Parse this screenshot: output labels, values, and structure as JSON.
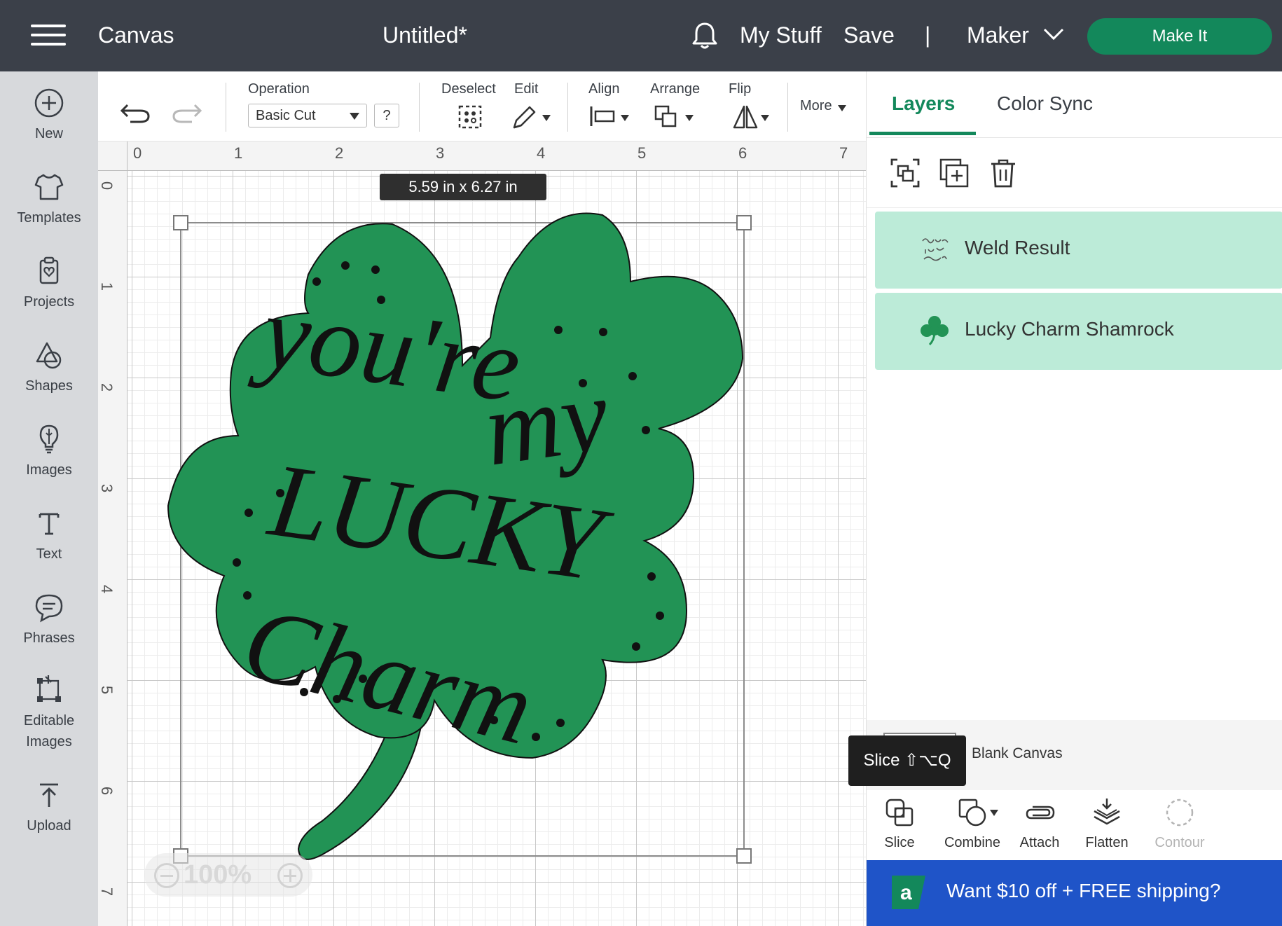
{
  "topbar": {
    "app_section": "Canvas",
    "document_title": "Untitled*",
    "my_stuff": "My Stuff",
    "save": "Save",
    "separator": "|",
    "machine": "Maker",
    "make_it": "Make It"
  },
  "sidebar": {
    "items": [
      {
        "label": "New",
        "icon": "plus-circle-icon"
      },
      {
        "label": "Templates",
        "icon": "shirt-icon"
      },
      {
        "label": "Projects",
        "icon": "clipboard-heart-icon"
      },
      {
        "label": "Shapes",
        "icon": "shapes-icon"
      },
      {
        "label": "Images",
        "icon": "lightbulb-icon"
      },
      {
        "label": "Text",
        "icon": "text-t-icon"
      },
      {
        "label": "Phrases",
        "icon": "speech-bubble-icon"
      },
      {
        "label": "Editable Images",
        "icon": "editable-image-icon"
      },
      {
        "label": "Upload",
        "icon": "upload-icon"
      }
    ]
  },
  "toolbar": {
    "operation_label": "Operation",
    "operation_value": "Basic Cut",
    "help": "?",
    "deselect": "Deselect",
    "edit": "Edit",
    "align": "Align",
    "arrange": "Arrange",
    "flip": "Flip",
    "more": "More"
  },
  "canvas": {
    "ruler_top": [
      "0",
      "1",
      "2",
      "3",
      "4",
      "5",
      "6",
      "7"
    ],
    "ruler_left": [
      "0",
      "1",
      "2",
      "3",
      "4",
      "5",
      "6",
      "7"
    ],
    "dimension": "5.59  in x 6.27  in",
    "zoom": "100%",
    "design_text": [
      "you're",
      "my",
      "LUCKY",
      "Charm"
    ],
    "colors": {
      "shamrock": "#229355",
      "text": "#111111"
    }
  },
  "panel": {
    "tabs": [
      "Layers",
      "Color Sync"
    ],
    "layers": [
      {
        "name": "Weld Result",
        "thumb": "text-thumb-icon"
      },
      {
        "name": "Lucky Charm Shamrock",
        "thumb": "shamrock-icon"
      }
    ],
    "blank_canvas": "Blank Canvas",
    "tooltip": "Slice ⇧⌥Q",
    "tools": [
      {
        "label": "Slice",
        "enabled": true
      },
      {
        "label": "Combine",
        "enabled": true
      },
      {
        "label": "Attach",
        "enabled": true
      },
      {
        "label": "Flatten",
        "enabled": true
      },
      {
        "label": "Contour",
        "enabled": false
      }
    ],
    "promo": "Want $10 off + FREE shipping?",
    "promo_logo": "a"
  },
  "colors": {
    "accent": "#13885b",
    "topbar": "#3b4049",
    "layer_bg": "#bcebd8",
    "promo": "#1f54c8"
  }
}
